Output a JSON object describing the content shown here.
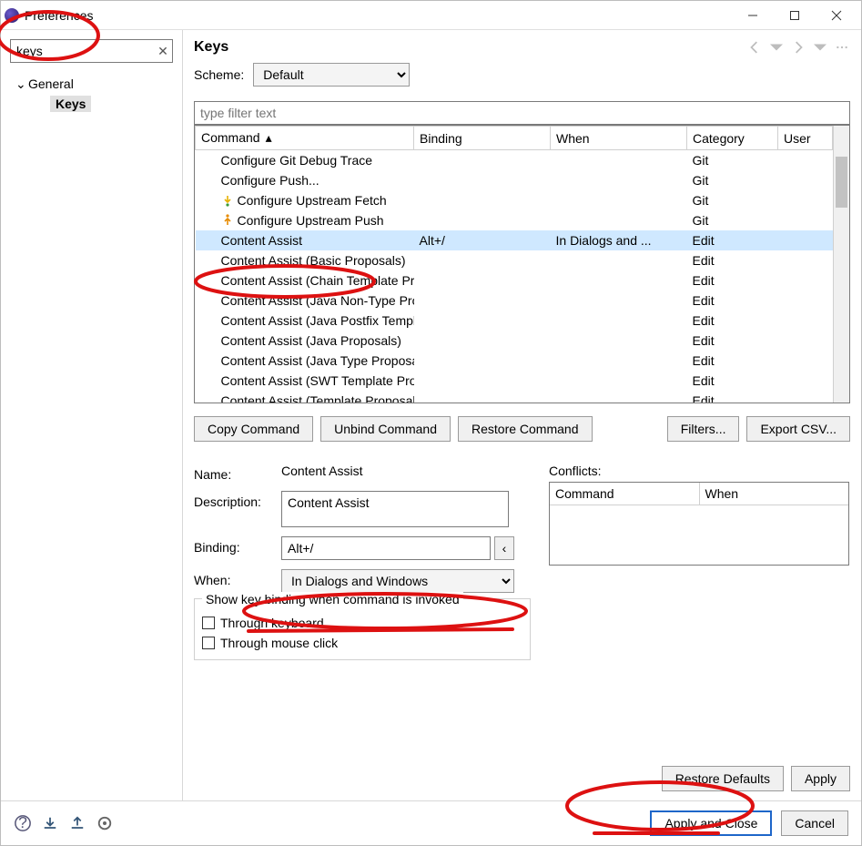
{
  "window": {
    "title": "Preferences"
  },
  "sidebar": {
    "filter_value": "keys",
    "tree": {
      "root": "General",
      "child": "Keys"
    }
  },
  "page": {
    "title": "Keys",
    "scheme_label": "Scheme:",
    "scheme_value": "Default",
    "filter_placeholder": "type filter text",
    "columns": {
      "command": "Command",
      "binding": "Binding",
      "when_": "When",
      "category": "Category",
      "user": "User"
    },
    "rows": [
      {
        "command": "Configure Git Debug Trace",
        "binding": "",
        "when_": "",
        "category": "Git",
        "user": "",
        "icon": ""
      },
      {
        "command": "Configure Push...",
        "binding": "",
        "when_": "",
        "category": "Git",
        "user": "",
        "icon": ""
      },
      {
        "command": "Configure Upstream Fetch",
        "binding": "",
        "when_": "",
        "category": "Git",
        "user": "",
        "icon": "fetch"
      },
      {
        "command": "Configure Upstream Push",
        "binding": "",
        "when_": "",
        "category": "Git",
        "user": "",
        "icon": "push"
      },
      {
        "command": "Content Assist",
        "binding": "Alt+/",
        "when_": "In Dialogs and ...",
        "category": "Edit",
        "user": "",
        "icon": "",
        "selected": true
      },
      {
        "command": "Content Assist (Basic Proposals)",
        "binding": "",
        "when_": "",
        "category": "Edit",
        "user": "",
        "icon": ""
      },
      {
        "command": "Content Assist (Chain Template Proposals)",
        "binding": "",
        "when_": "",
        "category": "Edit",
        "user": "",
        "icon": ""
      },
      {
        "command": "Content Assist (Java Non-Type Proposals)",
        "binding": "",
        "when_": "",
        "category": "Edit",
        "user": "",
        "icon": ""
      },
      {
        "command": "Content Assist (Java Postfix Template Proposals)",
        "binding": "",
        "when_": "",
        "category": "Edit",
        "user": "",
        "icon": ""
      },
      {
        "command": "Content Assist (Java Proposals)",
        "binding": "",
        "when_": "",
        "category": "Edit",
        "user": "",
        "icon": ""
      },
      {
        "command": "Content Assist (Java Type Proposals)",
        "binding": "",
        "when_": "",
        "category": "Edit",
        "user": "",
        "icon": ""
      },
      {
        "command": "Content Assist (SWT Template Proposals)",
        "binding": "",
        "when_": "",
        "category": "Edit",
        "user": "",
        "icon": ""
      },
      {
        "command": "Content Assist (Template Proposals)",
        "binding": "",
        "when_": "",
        "category": "Edit",
        "user": "",
        "icon": ""
      }
    ],
    "buttons": {
      "copy": "Copy Command",
      "unbind": "Unbind Command",
      "restore_cmd": "Restore Command",
      "filters": "Filters...",
      "export": "Export CSV..."
    },
    "detail": {
      "name_label": "Name:",
      "name_value": "Content Assist",
      "desc_label": "Description:",
      "desc_value": "Content Assist",
      "binding_label": "Binding:",
      "binding_value": "Alt+/",
      "when_label": "When:",
      "when_value": "In Dialogs and Windows"
    },
    "conflicts": {
      "title": "Conflicts:",
      "col_command": "Command",
      "col_when": "When"
    },
    "show_binding": {
      "legend": "Show key binding when command is invoked",
      "through_keyboard": "Through keyboard",
      "through_mouse": "Through mouse click"
    },
    "restore_defaults": "Restore Defaults",
    "apply": "Apply"
  },
  "footer": {
    "apply_close": "Apply and Close",
    "cancel": "Cancel"
  }
}
